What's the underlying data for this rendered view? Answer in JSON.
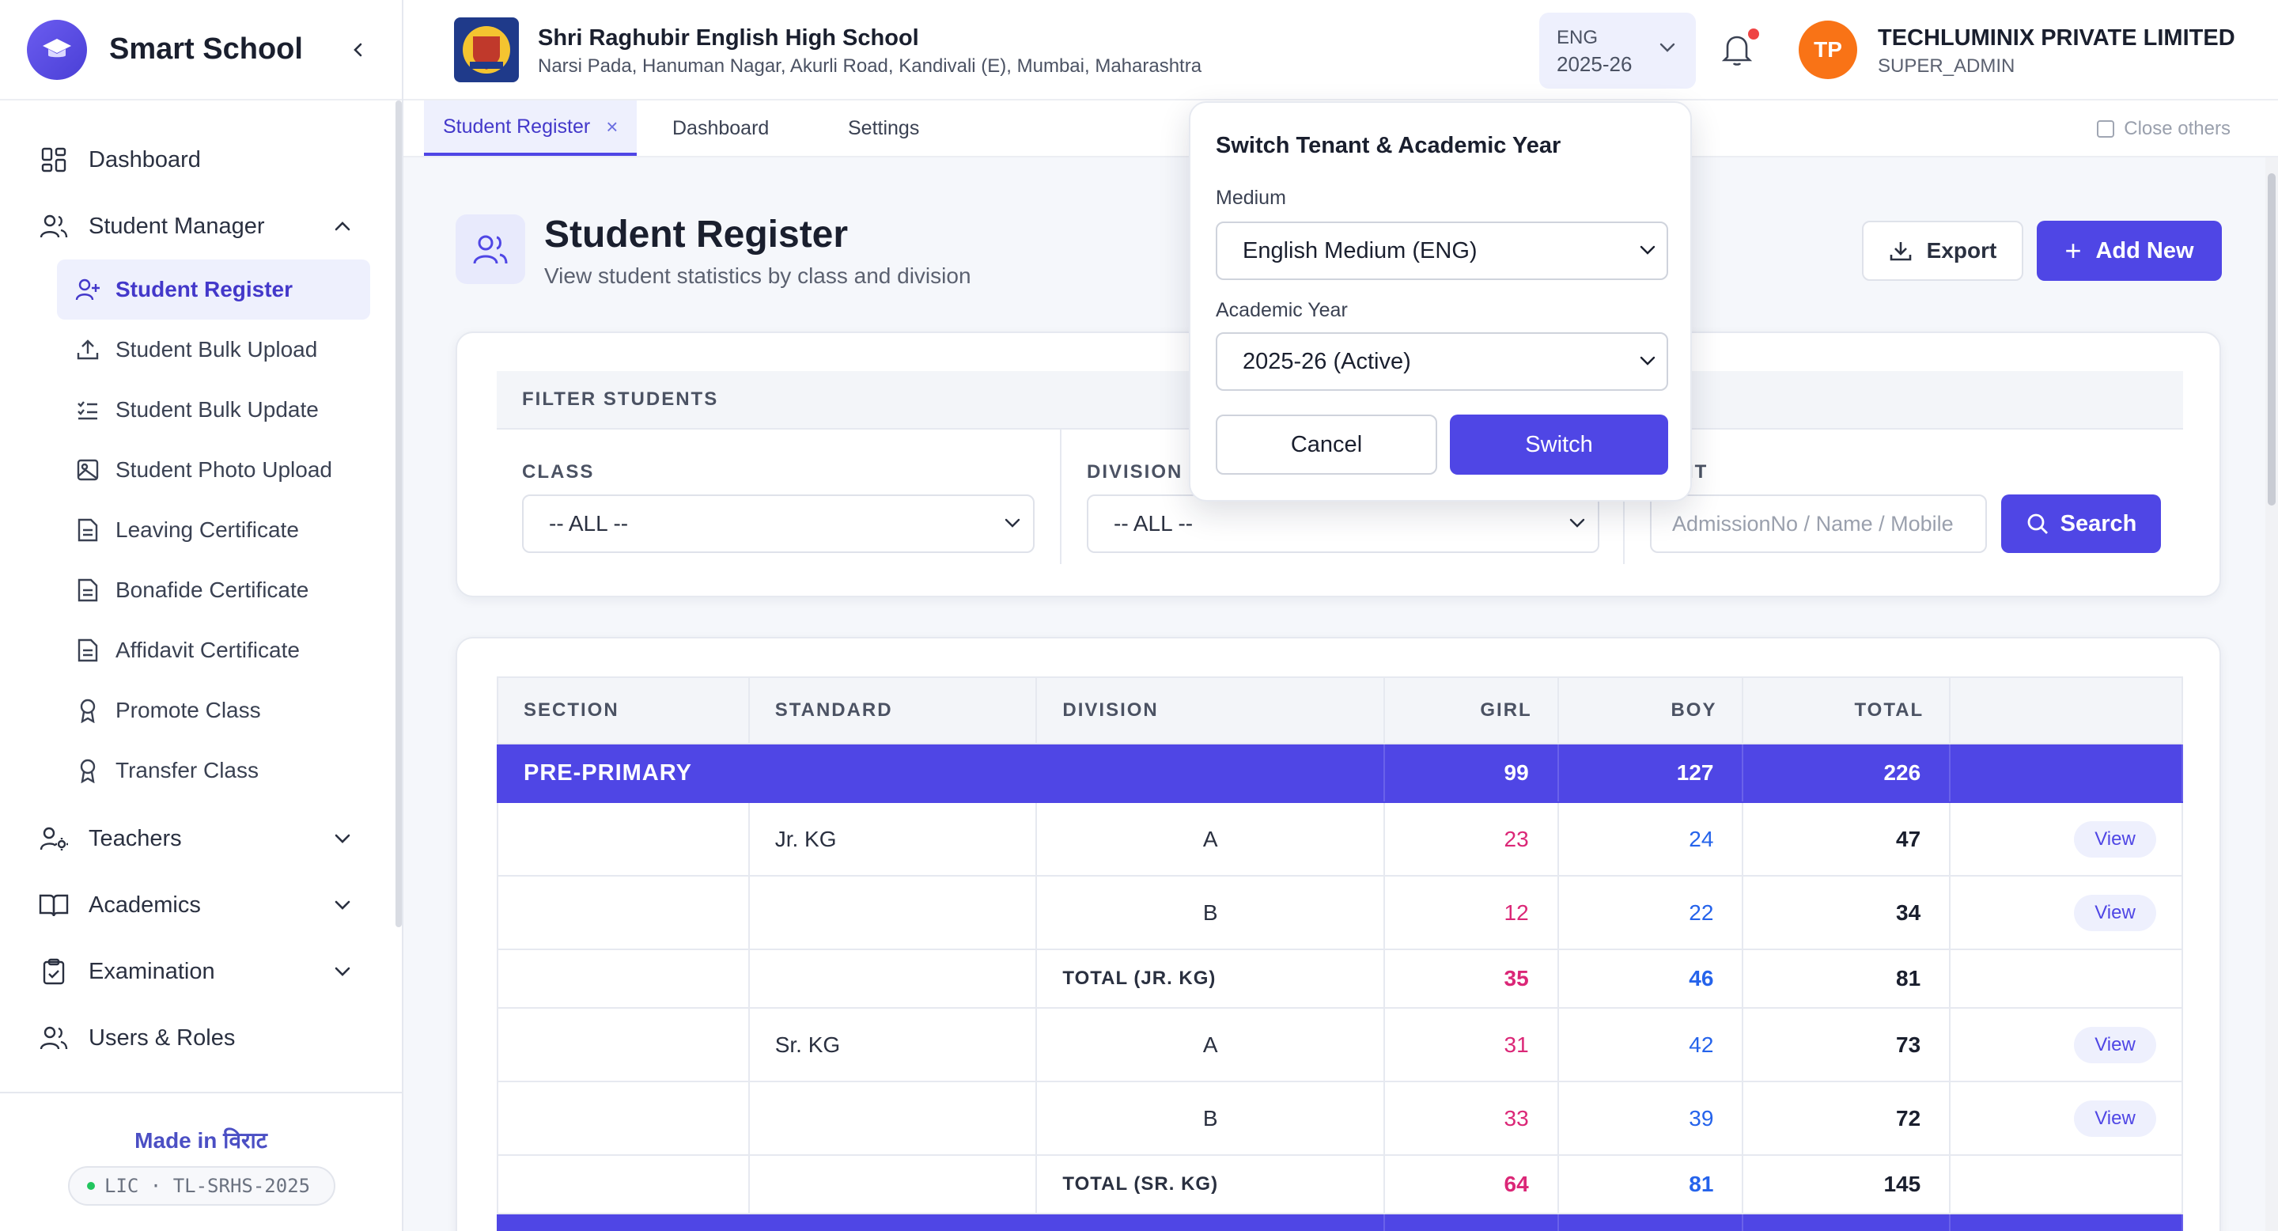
{
  "app": {
    "brand": "Smart School"
  },
  "sidebar": {
    "items": [
      {
        "label": "Dashboard"
      },
      {
        "label": "Student Manager"
      },
      {
        "label": "Teachers"
      },
      {
        "label": "Academics"
      },
      {
        "label": "Examination"
      },
      {
        "label": "Users & Roles"
      }
    ],
    "student_manager_sub": [
      {
        "label": "Student Register"
      },
      {
        "label": "Student Bulk Upload"
      },
      {
        "label": "Student Bulk Update"
      },
      {
        "label": "Student Photo Upload"
      },
      {
        "label": "Leaving Certificate"
      },
      {
        "label": "Bonafide Certificate"
      },
      {
        "label": "Affidavit Certificate"
      },
      {
        "label": "Promote Class"
      },
      {
        "label": "Transfer Class"
      }
    ],
    "footer": {
      "made_in": "Made in विराट",
      "license": "LIC · TL-SRHS-2025"
    }
  },
  "header": {
    "school_name": "Shri Raghubir English High School",
    "school_address": "Narsi Pada, Hanuman Nagar, Akurli Road, Kandivali (E), Mumbai, Maharashtra",
    "medium_code": "ENG",
    "academic_year": "2025-26",
    "avatar_initials": "TP",
    "org_name": "TECHLUMINIX PRIVATE LIMITED",
    "role": "SUPER_ADMIN"
  },
  "tabs": [
    {
      "label": "Student Register",
      "close": "×"
    },
    {
      "label": "Dashboard"
    },
    {
      "label": "Settings"
    }
  ],
  "tabs_close_others": "Close others",
  "page": {
    "title": "Student Register",
    "subtitle": "View student statistics by class and division",
    "export_label": "Export",
    "add_label": "Add New",
    "add_plus": "+"
  },
  "filter": {
    "heading": "FILTER STUDENTS",
    "class_label": "CLASS",
    "class_value": "-- ALL --",
    "division_label": "DIVISION",
    "division_value": "-- ALL --",
    "student_label": "DENT",
    "student_placeholder": "AdmissionNo / Name / Mobile",
    "search_label": "Search"
  },
  "table": {
    "headers": [
      "SECTION",
      "STANDARD",
      "DIVISION",
      "GIRL",
      "BOY",
      "TOTAL"
    ],
    "section": {
      "name": "PRE-PRIMARY",
      "girl": "99",
      "boy": "127",
      "total": "226"
    },
    "rows": [
      {
        "standard": "Jr. KG",
        "division": "A",
        "girl": "23",
        "boy": "24",
        "total": "47",
        "action": "View"
      },
      {
        "standard": "",
        "division": "B",
        "girl": "12",
        "boy": "22",
        "total": "34",
        "action": "View"
      },
      {
        "total_label": "TOTAL (JR. KG)",
        "girl": "35",
        "boy": "46",
        "total": "81"
      },
      {
        "standard": "Sr. KG",
        "division": "A",
        "girl": "31",
        "boy": "42",
        "total": "73",
        "action": "View"
      },
      {
        "standard": "",
        "division": "B",
        "girl": "33",
        "boy": "39",
        "total": "72",
        "action": "View"
      },
      {
        "total_label": "TOTAL (SR. KG)",
        "girl": "64",
        "boy": "81",
        "total": "145"
      }
    ]
  },
  "popover": {
    "title": "Switch Tenant & Academic Year",
    "medium_label": "Medium",
    "medium_value": "English Medium (ENG)",
    "year_label": "Academic Year",
    "year_value": "2025-26 (Active)",
    "cancel_label": "Cancel",
    "switch_label": "Switch"
  },
  "colors": {
    "accent": "#4f46e5",
    "girl": "#db2777",
    "boy": "#2563eb",
    "avatar": "#f97316"
  }
}
